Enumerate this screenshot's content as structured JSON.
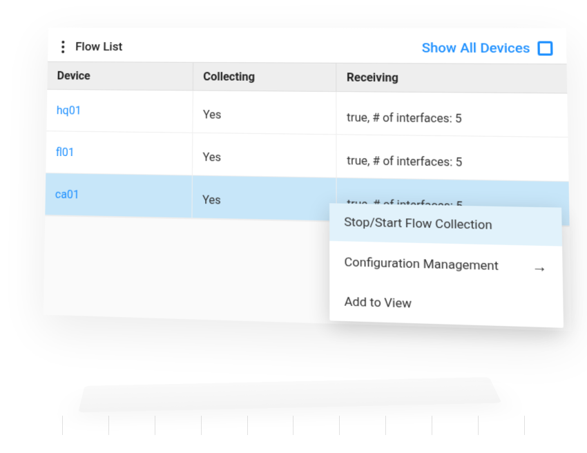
{
  "header": {
    "title": "Flow List",
    "showAllLabel": "Show All Devices"
  },
  "columns": {
    "device": "Device",
    "collecting": "Collecting",
    "receiving": "Receiving"
  },
  "rows": [
    {
      "device": "hq01",
      "collecting": "Yes",
      "receiving": "true, # of interfaces: 5",
      "selected": false
    },
    {
      "device": "fl01",
      "collecting": "Yes",
      "receiving": "true, # of interfaces: 5",
      "selected": false
    },
    {
      "device": "ca01",
      "collecting": "Yes",
      "receiving": "true, # of interfaces: 5",
      "selected": true
    }
  ],
  "contextMenu": {
    "items": [
      {
        "label": "Stop/Start Flow Collection",
        "highlighted": true,
        "hasSubmenu": false
      },
      {
        "label": "Configuration Management",
        "highlighted": false,
        "hasSubmenu": true
      },
      {
        "label": "Add to View",
        "highlighted": false,
        "hasSubmenu": false
      }
    ]
  }
}
